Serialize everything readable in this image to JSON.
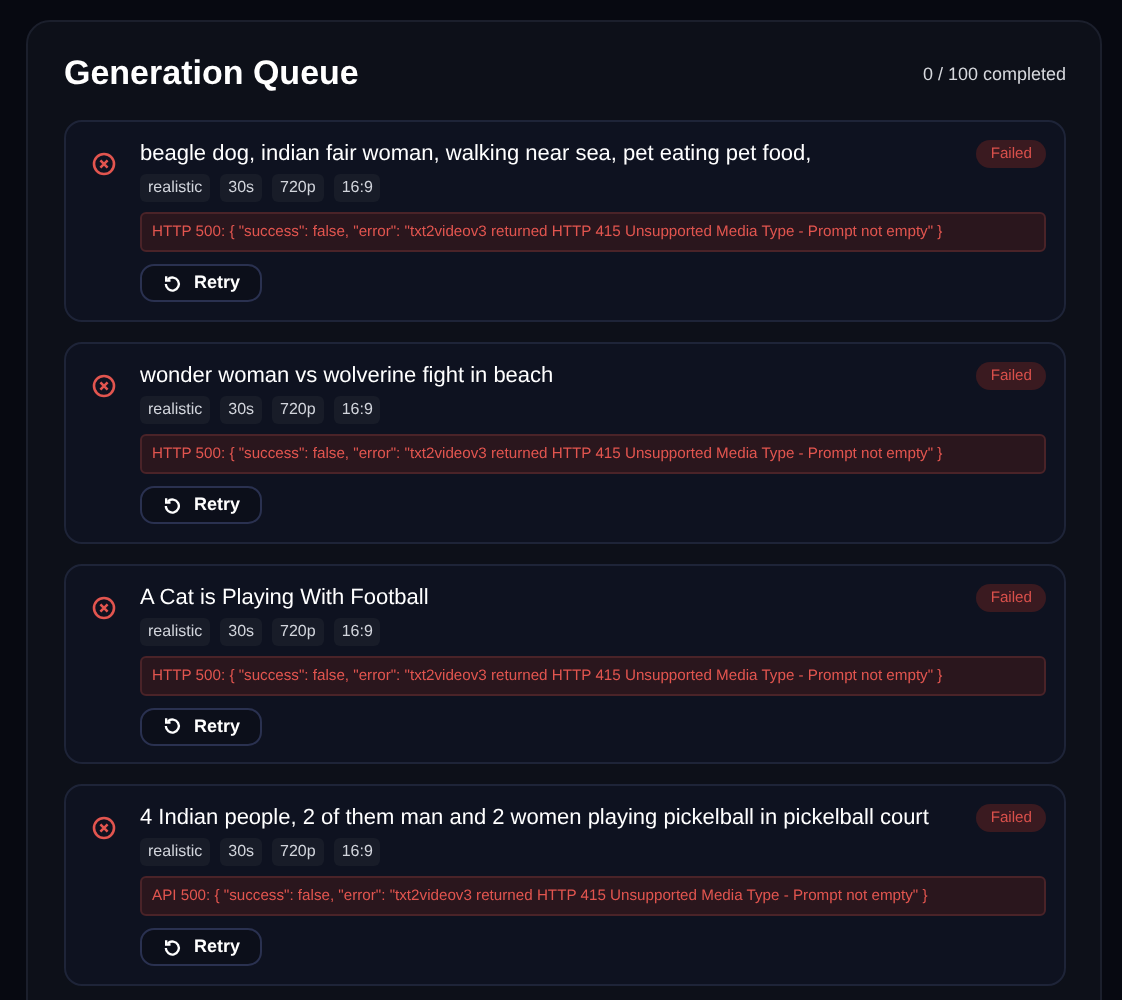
{
  "header": {
    "title": "Generation Queue",
    "progress": "0 / 100 completed"
  },
  "jobs": [
    {
      "status_label": "Failed",
      "prompt": "beagle dog, indian fair woman, walking near sea, pet eating pet food,",
      "tags": [
        "realistic",
        "30s",
        "720p",
        "16:9"
      ],
      "error": "HTTP 500: { \"success\": false, \"error\": \"txt2videov3 returned HTTP 415 Unsupported Media Type - Prompt not empty\" }",
      "action": "Retry"
    },
    {
      "status_label": "Failed",
      "prompt": "wonder woman vs wolverine fight in beach",
      "tags": [
        "realistic",
        "30s",
        "720p",
        "16:9"
      ],
      "error": "HTTP 500: { \"success\": false, \"error\": \"txt2videov3 returned HTTP 415 Unsupported Media Type - Prompt not empty\" }",
      "action": "Retry"
    },
    {
      "status_label": "Failed",
      "prompt": "A Cat is Playing With Football",
      "tags": [
        "realistic",
        "30s",
        "720p",
        "16:9"
      ],
      "error": "HTTP 500: { \"success\": false, \"error\": \"txt2videov3 returned HTTP 415 Unsupported Media Type - Prompt not empty\" }",
      "action": "Retry"
    },
    {
      "status_label": "Failed",
      "prompt": "4 Indian people, 2 of them man and 2 women playing pickelball in pickelball court",
      "tags": [
        "realistic",
        "30s",
        "720p",
        "16:9"
      ],
      "error": "API 500: { \"success\": false, \"error\": \"txt2videov3 returned HTTP 415 Unsupported Media Type - Prompt not empty\" }",
      "action": "Retry"
    }
  ]
}
